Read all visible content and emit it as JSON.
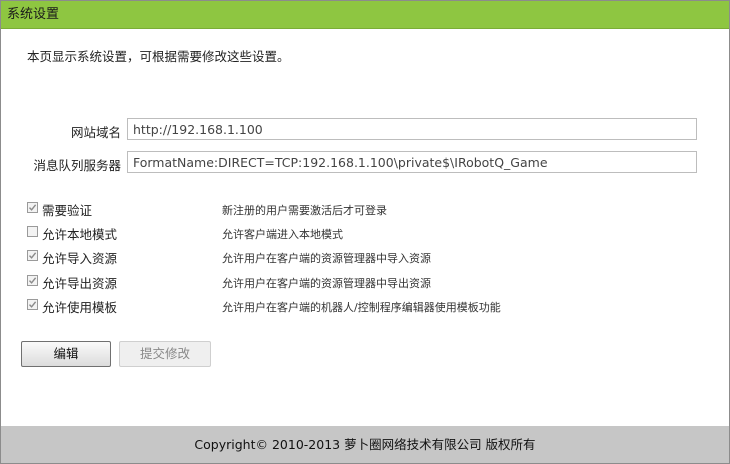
{
  "window": {
    "title": "系统设置"
  },
  "intro": "本页显示系统设置，可根据需要修改这些设置。",
  "fields": [
    {
      "label": "网站域名",
      "value": "http://192.168.1.100"
    },
    {
      "label": "消息队列服务器",
      "value": "FormatName:DIRECT=TCP:192.168.1.100\\private$\\IRobotQ_Game"
    }
  ],
  "options": [
    {
      "label": "需要验证",
      "checked": true,
      "description": "新注册的用户需要激活后才可登录"
    },
    {
      "label": "允许本地模式",
      "checked": false,
      "description": "允许客户端进入本地模式"
    },
    {
      "label": "允许导入资源",
      "checked": true,
      "description": "允许用户在客户端的资源管理器中导入资源"
    },
    {
      "label": "允许导出资源",
      "checked": true,
      "description": "允许用户在客户端的资源管理器中导出资源"
    },
    {
      "label": "允许使用模板",
      "checked": true,
      "description": "允许用户在客户端的机器人/控制程序编辑器使用模板功能"
    }
  ],
  "buttons": {
    "edit": "编辑",
    "submit": "提交修改"
  },
  "footer": "Copyright© 2010-2013 萝卜圈网络技术有限公司 版权所有"
}
